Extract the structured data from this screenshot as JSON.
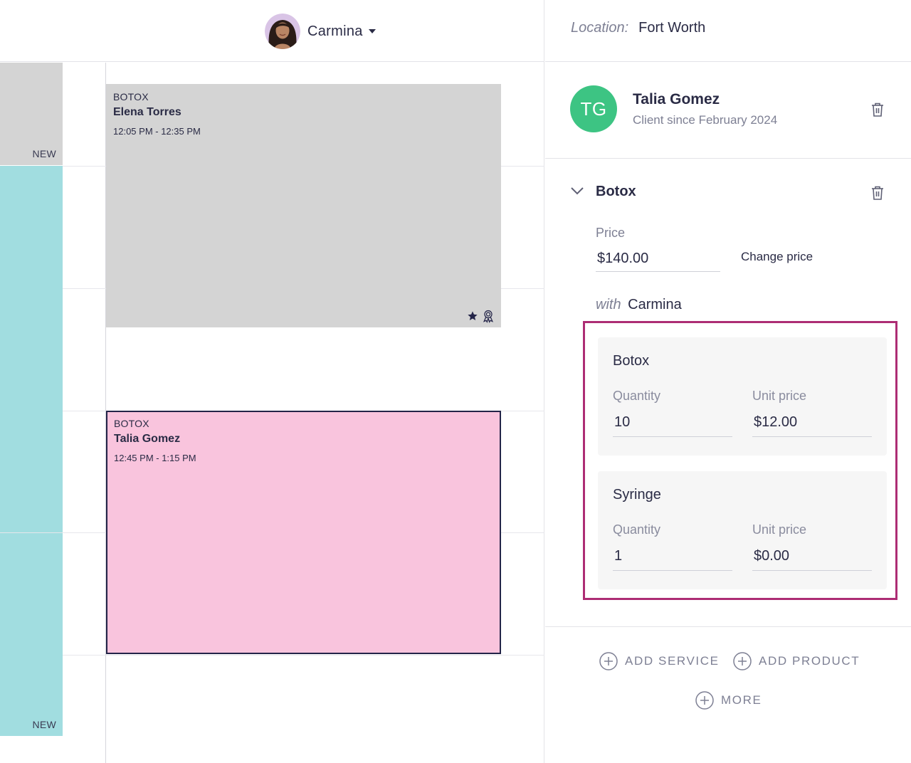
{
  "calendar": {
    "staff_name": "Carmina",
    "new_label_top": "NEW",
    "new_label_bottom": "NEW",
    "appointments": [
      {
        "service": "BOTOX",
        "client": "Elena Torres",
        "time": "12:05 PM - 12:35 PM",
        "color": "#d4d4d4"
      },
      {
        "service": "BOTOX",
        "client": "Talia Gomez",
        "time": "12:45 PM - 1:15 PM",
        "color": "#f9c4dd"
      }
    ]
  },
  "panel": {
    "location_label": "Location:",
    "location_value": "Fort Worth",
    "client": {
      "initials": "TG",
      "name": "Talia Gomez",
      "since": "Client since February 2024",
      "avatar_color": "#3dc483"
    },
    "service": {
      "title": "Botox",
      "price_label": "Price",
      "price_value": "$140.00",
      "change_price": "Change price",
      "with_label": "with",
      "with_value": "Carmina"
    },
    "products": [
      {
        "name": "Botox",
        "quantity_label": "Quantity",
        "quantity": "10",
        "unit_price_label": "Unit price",
        "unit_price": "$12.00"
      },
      {
        "name": "Syringe",
        "quantity_label": "Quantity",
        "quantity": "1",
        "unit_price_label": "Unit price",
        "unit_price": "$0.00"
      }
    ],
    "actions": {
      "add_service": "ADD SERVICE",
      "add_product": "ADD PRODUCT",
      "more": "MORE"
    },
    "highlight_color": "#ad2d74"
  }
}
